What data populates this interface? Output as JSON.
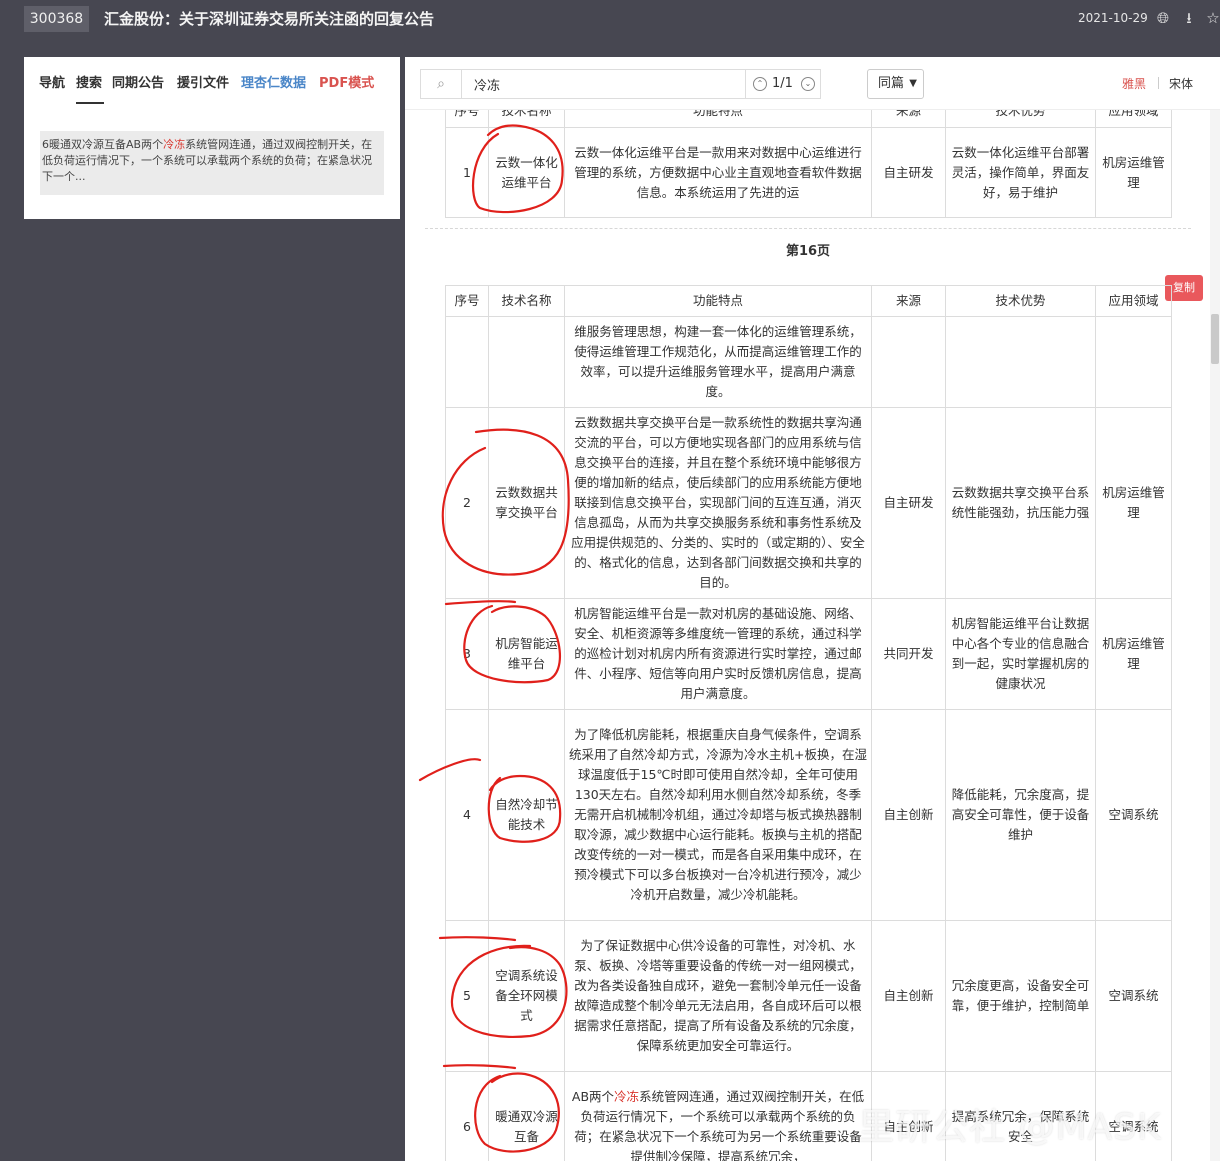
{
  "header": {
    "code": "300368",
    "title": "汇金股份：关于深圳证券交易所关注函的回复公告",
    "date": "2021-10-29",
    "icons": [
      "globe-icon",
      "download-icon",
      "star-icon"
    ]
  },
  "left_panel": {
    "tabs": [
      {
        "label": "导航"
      },
      {
        "label": "搜索"
      },
      {
        "label": "同期公告"
      },
      {
        "label": "援引文件"
      },
      {
        "label": "理杏仁数据"
      },
      {
        "label": "PDF模式"
      }
    ],
    "result": {
      "before": "6暖通双冷源互备AB两个",
      "highlight": "冷冻",
      "after": "系统管网连通，通过双阀控制开关，在低负荷运行情况下，一个系统可以承载两个系统的负荷；在紧急状况下一个..."
    }
  },
  "toolbar": {
    "search_value": "冷冻",
    "match_count": "1/1",
    "scope": "同篇",
    "font_options": [
      "雅黑",
      "宋体"
    ]
  },
  "page": {
    "label": "第16页",
    "copy_label": "复制"
  },
  "table_top": {
    "header": [
      "序号",
      "技术名称",
      "功能特点",
      "来源",
      "技术优势",
      "应用领域"
    ],
    "row": {
      "no": "1",
      "name": "云数一体化运维平台",
      "desc": "云数一体化运维平台是一款用来对数据中心运维进行管理的系统，方便数据中心业主直观地查看软件数据信息。本系统运用了先进的运",
      "source": "自主研发",
      "adv": "云数一体化运维平台部署灵活，操作简单，界面友好，易于维护",
      "field": "机房运维管理"
    }
  },
  "table": {
    "header": [
      "序号",
      "技术名称",
      "功能特点",
      "来源",
      "技术优势",
      "应用领域"
    ],
    "rows": [
      {
        "no": "",
        "name": "",
        "desc": "维服务管理思想，构建一套一体化的运维管理系统，使得运维管理工作规范化，从而提高运维管理工作的效率，可以提升运维服务管理水平，提高用户满意度。",
        "source": "",
        "adv": "",
        "field": ""
      },
      {
        "no": "2",
        "name": "云数数据共享交换平台",
        "desc": "云数数据共享交换平台是一款系统性的数据共享沟通交流的平台，可以方便地实现各部门的应用系统与信息交换平台的连接，并且在整个系统环境中能够很方便的增加新的结点，使后续部门的应用系统能方便地联接到信息交换平台，实现部门间的互连互通，消灭信息孤岛，从而为共享交换服务系统和事务性系统及应用提供规范的、分类的、实时的（或定期的）、安全的、格式化的信息，达到各部门间数据交换和共享的目的。",
        "source": "自主研发",
        "adv": "云数数据共享交换平台系统性能强劲，抗压能力强",
        "field": "机房运维管理"
      },
      {
        "no": "3",
        "name": "机房智能运维平台",
        "desc": "机房智能运维平台是一款对机房的基础设施、网络、安全、机柜资源等多维度统一管理的系统，通过科学的巡检计划对机房内所有资源进行实时掌控，通过邮件、小程序、短信等向用户实时反馈机房信息，提高用户满意度。",
        "source": "共同开发",
        "adv": "机房智能运维平台让数据中心各个专业的信息融合到一起，实时掌握机房的健康状况",
        "field": "机房运维管理"
      },
      {
        "no": "4",
        "name": "自然冷却节能技术",
        "desc": "为了降低机房能耗，根据重庆自身气候条件，空调系统采用了自然冷却方式，冷源为冷水主机+板换，在湿球温度低于15℃时即可使用自然冷却，全年可使用130天左右。自然冷却利用水侧自然冷却系统，冬季无需开启机械制冷机组，通过冷却塔与板式换热器制取冷源，减少数据中心运行能耗。板换与主机的搭配改变传统的一对一模式，而是各自采用集中成环，在预冷模式下可以多台板换对一台冷机进行预冷，减少冷机开启数量，减少冷机能耗。",
        "source": "自主创新",
        "adv": "降低能耗，冗余度高，提高安全可靠性，便于设备维护",
        "field": "空调系统"
      },
      {
        "no": "5",
        "name": "空调系统设备全环网模式",
        "desc": "为了保证数据中心供冷设备的可靠性，对冷机、水泵、板换、冷塔等重要设备的传统一对一组网模式，改为各类设备独自成环，避免一套制冷单元任一设备故障造成整个制冷单元无法启用，各自成环后可以根据需求任意搭配，提高了所有设备及系统的冗余度，保障系统更加安全可靠运行。",
        "source": "自主创新",
        "adv": "冗余度更高，设备安全可靠，便于维护，控制简单",
        "field": "空调系统"
      },
      {
        "no": "6",
        "name": "暖通双冷源互备",
        "desc_before": "AB两个",
        "desc_hl": "冷冻",
        "desc_after": "系统管网连通，通过双阀控制开关，在低负荷运行情况下，一个系统可以承载两个系统的负荷；在紧急状况下一个系统可为另一个系统重要设备提供制冷保障，提高系统冗余，",
        "source": "自主创新",
        "adv": "提高系统冗余，保障系统安全",
        "field": "空调系统"
      }
    ]
  },
  "watermark": "里研公社 @MASK",
  "colors": {
    "background": "#474751",
    "highlight": "#d9362e",
    "copy_button": "#e9585c",
    "annotation": "#e0201b"
  }
}
